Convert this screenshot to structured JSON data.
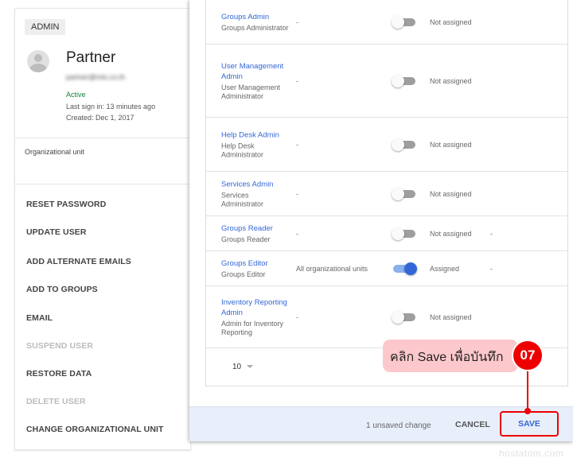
{
  "user": {
    "badge": "ADMIN",
    "name": "Partner",
    "email": "partner@mts.co.th",
    "status": "Active",
    "last_sign_in": "Last sign in: 13 minutes ago",
    "created": "Created: Dec 1, 2017",
    "org_unit_label": "Organizational unit"
  },
  "actions": [
    {
      "label": "RESET PASSWORD",
      "enabled": true
    },
    {
      "label": "UPDATE USER",
      "enabled": true
    },
    {
      "label": "ADD ALTERNATE EMAILS",
      "enabled": true
    },
    {
      "label": "ADD TO GROUPS",
      "enabled": true
    },
    {
      "label": "EMAIL",
      "enabled": true
    },
    {
      "label": "SUSPEND USER",
      "enabled": false
    },
    {
      "label": "RESTORE DATA",
      "enabled": true
    },
    {
      "label": "DELETE USER",
      "enabled": false
    },
    {
      "label": "CHANGE ORGANIZATIONAL UNIT",
      "enabled": true
    }
  ],
  "roles": [
    {
      "name": "Groups Admin",
      "desc": "Groups Administrator",
      "scope": "-",
      "assigned": false,
      "status": "Not assigned",
      "extra": ""
    },
    {
      "name": "User Management Admin",
      "desc": "User Management Administrator",
      "scope": "-",
      "assigned": false,
      "status": "Not assigned",
      "extra": ""
    },
    {
      "name": "Help Desk Admin",
      "desc": "Help Desk Administrator",
      "scope": "-",
      "assigned": false,
      "status": "Not assigned",
      "extra": ""
    },
    {
      "name": "Services Admin",
      "desc": "Services Administrator",
      "scope": "-",
      "assigned": false,
      "status": "Not assigned",
      "extra": ""
    },
    {
      "name": "Groups Reader",
      "desc": "Groups Reader",
      "scope": "-",
      "assigned": false,
      "status": "Not assigned",
      "extra": "-"
    },
    {
      "name": "Groups Editor",
      "desc": "Groups Editor",
      "scope": "All organizational units",
      "assigned": true,
      "status": "Assigned",
      "extra": "-"
    },
    {
      "name": "Inventory Reporting Admin",
      "desc": "Admin for Inventory Reporting",
      "scope": "-",
      "assigned": false,
      "status": "Not assigned",
      "extra": ""
    }
  ],
  "pager": {
    "page_size": "10"
  },
  "footer": {
    "unsaved": "1 unsaved change",
    "cancel": "CANCEL",
    "save": "SAVE"
  },
  "annotation": {
    "text": "คลิก Save เพื่อบันทึก",
    "step": "07"
  },
  "watermark": "hostatom.com",
  "colors": {
    "accent": "#3367d6",
    "annotation": "#ee0000",
    "active": "#188038"
  }
}
